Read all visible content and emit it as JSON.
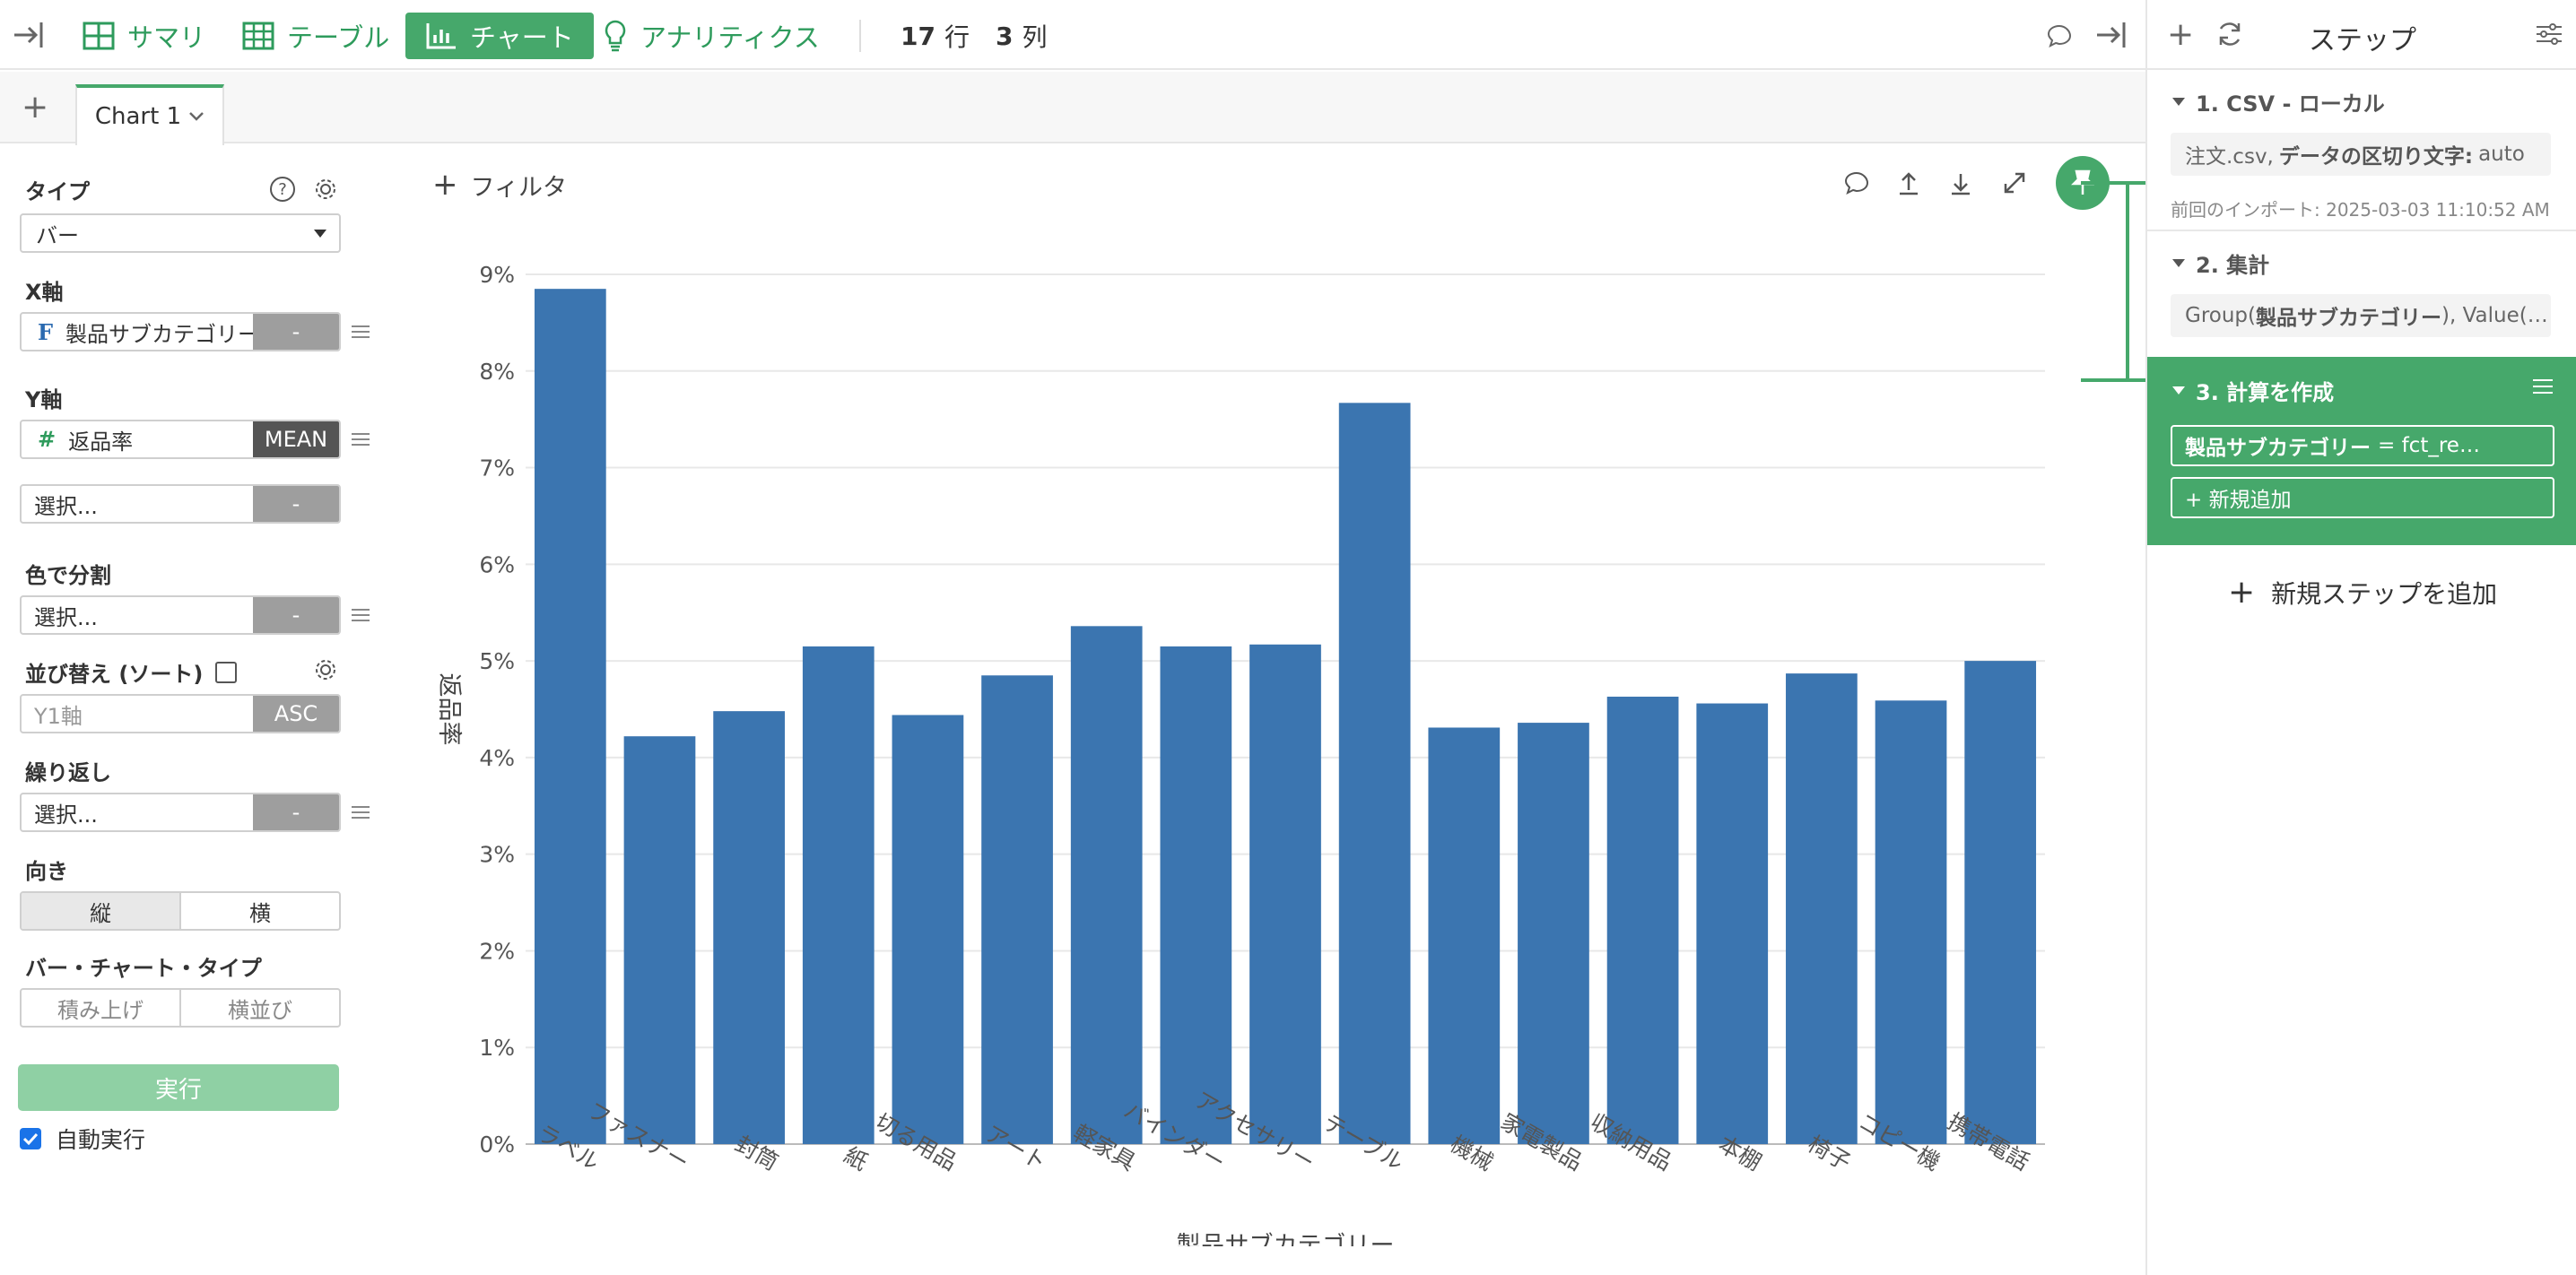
{
  "toolbar": {
    "tabs": [
      {
        "label": "サマリ",
        "icon": "grid-icon"
      },
      {
        "label": "テーブル",
        "icon": "table-icon"
      },
      {
        "label": "チャート",
        "icon": "bar-chart-icon"
      },
      {
        "label": "アナリティクス",
        "icon": "lightbulb-icon"
      }
    ],
    "rows_count": "17",
    "rows_unit": "行",
    "cols_count": "3",
    "cols_unit": "列"
  },
  "tabbar": {
    "add_label": "+",
    "chart_tab": "Chart 1"
  },
  "config": {
    "type_label": "タイプ",
    "type_value": "バー",
    "x_label": "X軸",
    "x_field": "製品サブカテゴリー",
    "x_field_type": "F",
    "x_agg": "-",
    "y_label": "Y軸",
    "y_field": "返品率",
    "y_field_type": "#",
    "y_agg": "MEAN",
    "y2_placeholder": "選択...",
    "y2_agg": "-",
    "color_label": "色で分割",
    "color_placeholder": "選択...",
    "color_agg": "-",
    "sort_label": "並び替え (ソート)",
    "sort_placeholder": "Y1軸",
    "sort_order": "ASC",
    "repeat_label": "繰り返し",
    "repeat_placeholder": "選択...",
    "repeat_agg": "-",
    "orientation_label": "向き",
    "orientation_options": [
      "縦",
      "横"
    ],
    "bar_type_label": "バー・チャート・タイプ",
    "bar_type_options": [
      "積み上げ",
      "横並び"
    ],
    "run_label": "実行",
    "auto_run_label": "自動実行"
  },
  "chart_toolbar": {
    "filter_label": "フィルタ"
  },
  "chart_data": {
    "type": "bar",
    "categories": [
      "ラベル",
      "ファスナー",
      "封筒",
      "紙",
      "切る用品",
      "アート",
      "軽家具",
      "バインダー",
      "アクセサリー",
      "テーブル",
      "機械",
      "家電製品",
      "収納用品",
      "本棚",
      "椅子",
      "コピー機",
      "携帯電話"
    ],
    "values": [
      8.85,
      4.22,
      4.48,
      5.15,
      4.44,
      4.85,
      5.36,
      5.15,
      5.17,
      7.67,
      4.31,
      4.36,
      4.63,
      4.56,
      4.87,
      4.59,
      5.0
    ],
    "ylim": [
      0,
      9
    ],
    "yticks": [
      "0%",
      "1%",
      "2%",
      "3%",
      "4%",
      "5%",
      "6%",
      "7%",
      "8%",
      "9%"
    ],
    "xlabel": "製品サブカテゴリー",
    "ylabel": "返品率",
    "grid": true,
    "bar_color": "#3b75b0"
  },
  "steps": {
    "title": "ステップ",
    "items": [
      {
        "title": "1. CSV - ローカル",
        "detail_a": "注文.csv,",
        "detail_b": "データの区切り文字:",
        "detail_c": "auto",
        "meta": "前回のインポート: 2025-03-03 11:10:52 AM"
      },
      {
        "title": "2. 集計",
        "detail_a": "Group(",
        "detail_b": "製品サブカテゴリー",
        "detail_c": "), Value(…"
      },
      {
        "title": "3. 計算を作成",
        "detail_b": "製品サブカテゴリー",
        "detail_c": "= fct_re…",
        "add_label": "+ 新規追加"
      }
    ],
    "add_step_label": "新規ステップを追加"
  },
  "colors": {
    "accent": "#46a86b",
    "bar": "#3b75b0"
  }
}
